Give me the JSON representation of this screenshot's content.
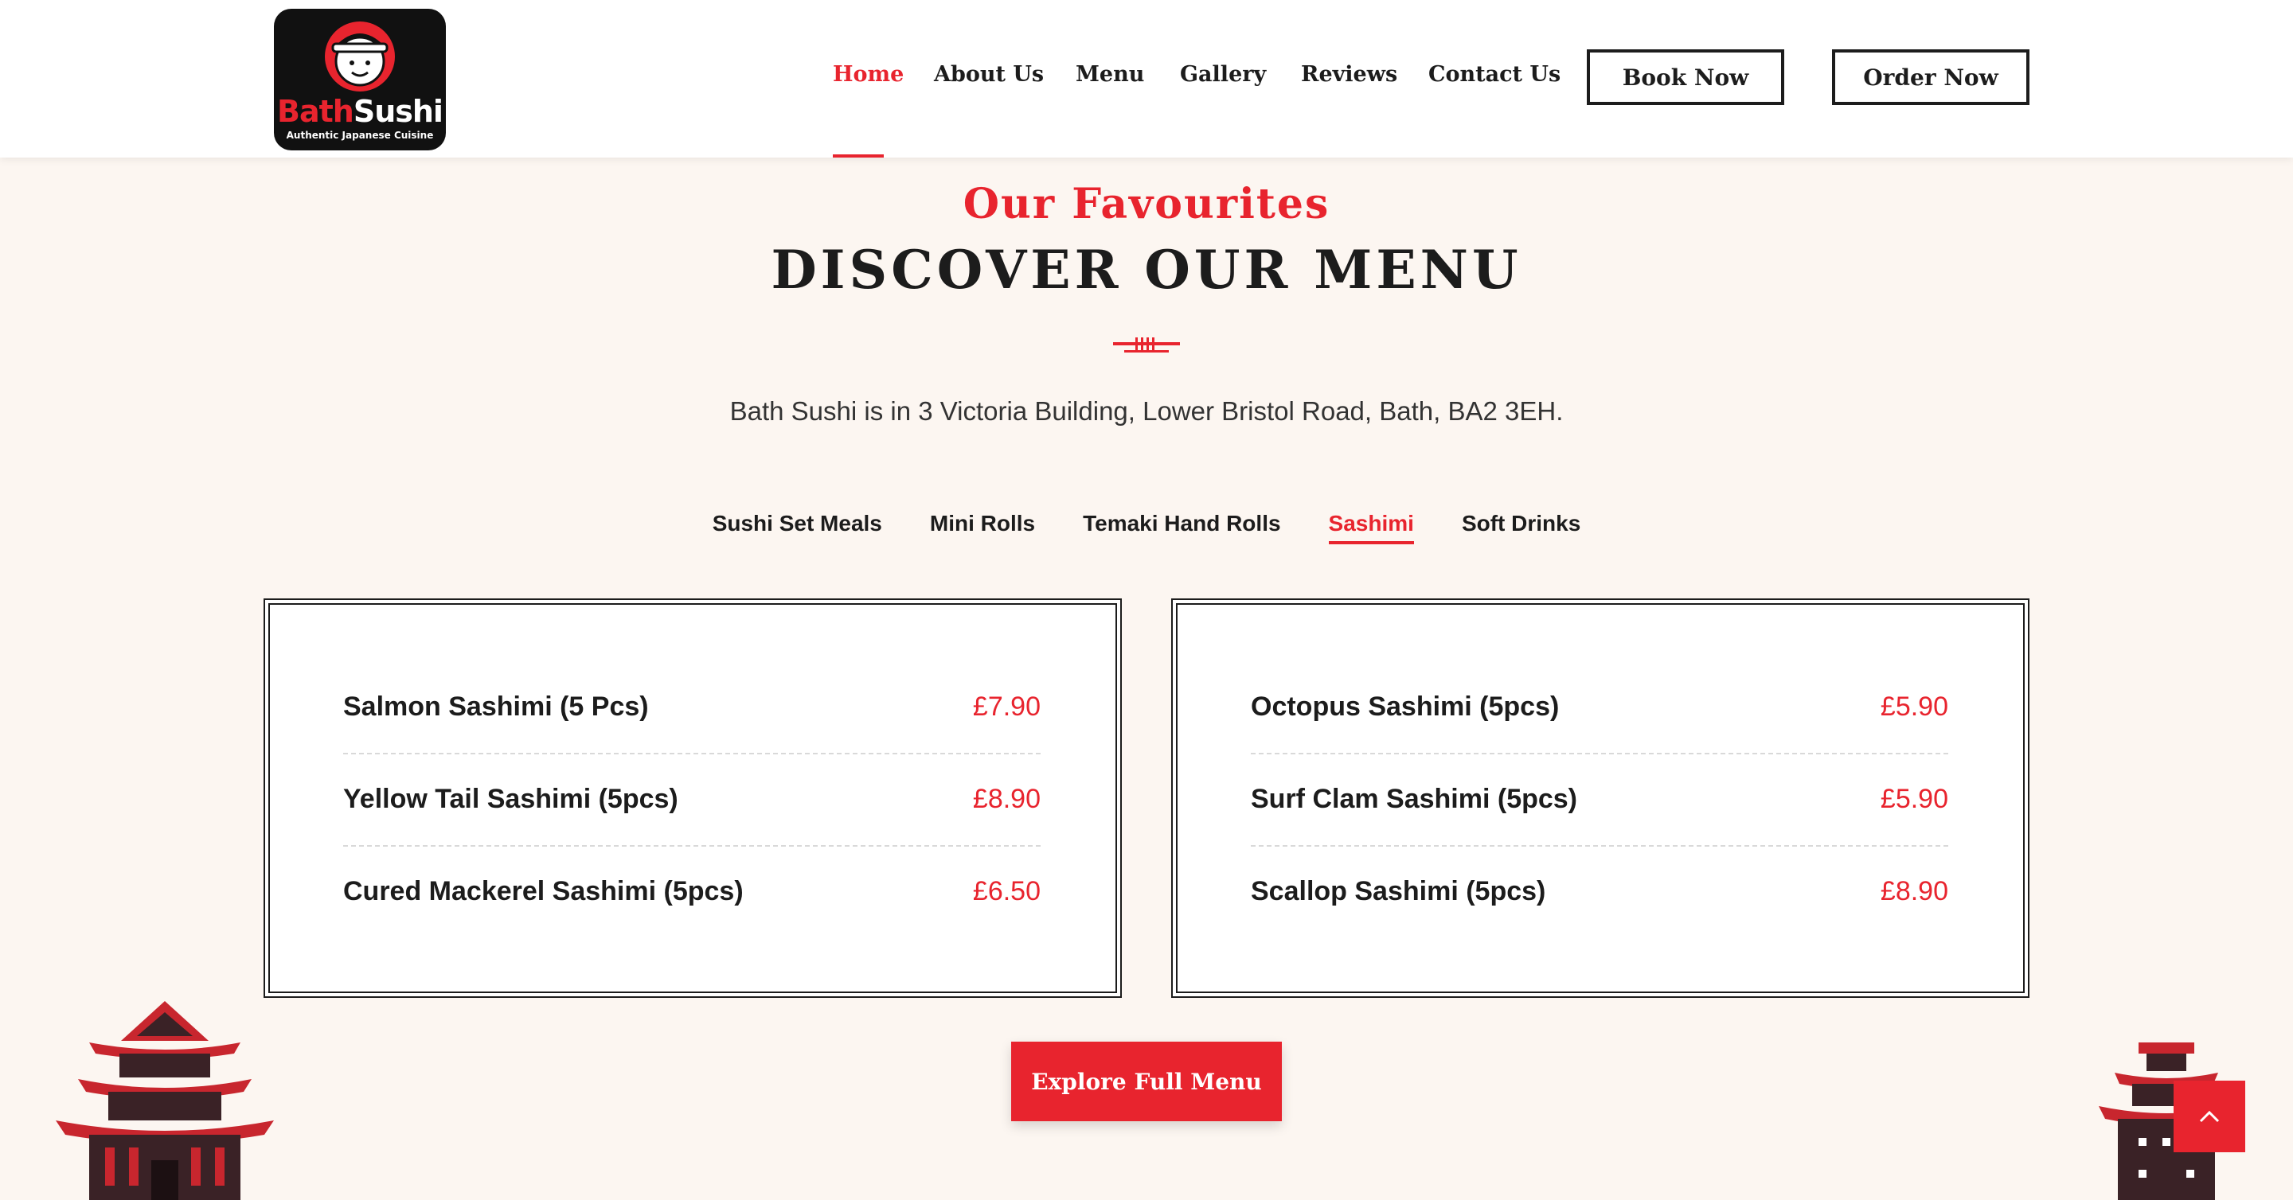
{
  "brand": {
    "logo_name": "BathSushi",
    "logo_name_part1": "Bath",
    "logo_name_part2": "Sushi",
    "logo_tagline": "Authentic Japanese Cuisine",
    "colors": {
      "accent": "#e8242e",
      "dark": "#1c1c1c",
      "background": "#fcf6f1"
    }
  },
  "nav": {
    "items": [
      {
        "label": "Home",
        "active": true
      },
      {
        "label": "About Us",
        "active": false
      },
      {
        "label": "Menu",
        "active": false
      },
      {
        "label": "Gallery",
        "active": false
      },
      {
        "label": "Reviews",
        "active": false
      },
      {
        "label": "Contact Us",
        "active": false
      }
    ],
    "book_label": "Book Now",
    "order_label": "Order Now"
  },
  "section": {
    "eyebrow": "Our Favourites",
    "heading": "DISCOVER OUR MENU",
    "address": "Bath Sushi is in 3 Victoria Building, Lower Bristol Road, Bath, BA2 3EH."
  },
  "tabs": [
    {
      "label": "Sushi Set Meals",
      "active": false
    },
    {
      "label": "Mini Rolls",
      "active": false
    },
    {
      "label": "Temaki Hand Rolls",
      "active": false
    },
    {
      "label": "Sashimi",
      "active": true
    },
    {
      "label": "Soft Drinks",
      "active": false
    }
  ],
  "menu": {
    "left": [
      {
        "name": "Salmon Sashimi (5 Pcs)",
        "price": "£7.90"
      },
      {
        "name": "Yellow Tail Sashimi (5pcs)",
        "price": "£8.90"
      },
      {
        "name": "Cured Mackerel Sashimi (5pcs)",
        "price": "£6.50"
      }
    ],
    "right": [
      {
        "name": "Octopus Sashimi (5pcs)",
        "price": "£5.90"
      },
      {
        "name": "Surf Clam Sashimi (5pcs)",
        "price": "£5.90"
      },
      {
        "name": "Scallop Sashimi (5pcs)",
        "price": "£8.90"
      }
    ]
  },
  "cta": {
    "label": "Explore Full Menu"
  },
  "icons": {
    "scroll_top": "chevron-up-icon",
    "divider": "chopsticks-divider-icon",
    "pagoda": "pagoda-icon"
  }
}
